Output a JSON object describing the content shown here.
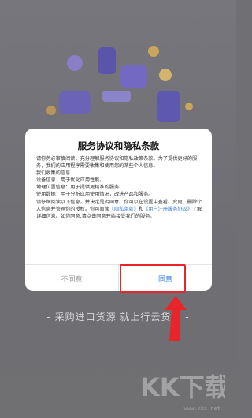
{
  "dialog": {
    "title": "服务协议和隐私条款",
    "intro": "请你务必审慎阅读，充分理解服务协议和隐私政策条款。为了提供更好的服务，我们的应用程序需要收集和使用您的某些个人信息。",
    "collected_heading": "我们收集的信息",
    "item1": "设备信息：用于优化应用性能。",
    "item2": "地理位置信息：用于提供更精准的服务。",
    "item3": "使用数据：用于分析应用使用情况，改进产品和服务。",
    "rights": "请仔细阅读以下信息，并决定是否同意。你可以在设置中查看、变更、删除个人信息并管理你的授权。你可阅读",
    "privacy_link": "《隐私条款》",
    "and_text": "和",
    "terms_link": "《用户注册服务协议》",
    "rights_tail": "了解详细信息。如你同意,请点击同意开始接受我们的服务。",
    "decline_label": "不同意",
    "agree_label": "同意"
  },
  "tagline": "- 采购进口货源 就上行云货仓 -",
  "watermark": {
    "logo": "KK下载",
    "url": "www.kkx.net"
  },
  "colors": {
    "accent": "#3a7be0",
    "highlight": "#e8252b"
  }
}
